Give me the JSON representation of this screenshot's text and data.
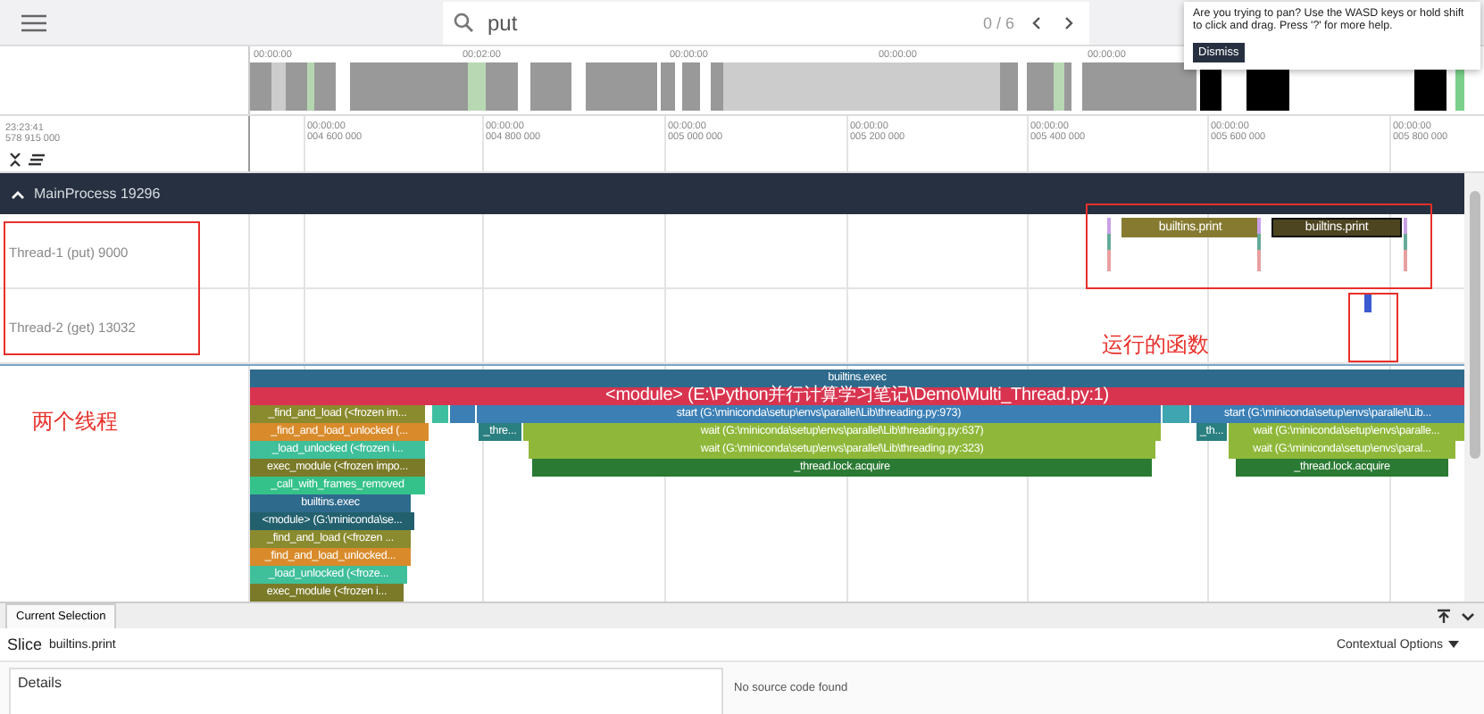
{
  "topbar": {
    "search": {
      "value": "put",
      "count": "0 / 6"
    }
  },
  "toast": {
    "message": "Are you trying to pan? Use the WASD keys or hold shift to click and drag. Press '?' for more help.",
    "button": "Dismiss"
  },
  "overview": {
    "labels": [
      "00:00:00",
      "00:02:00",
      "00:00:00",
      "00:00:00",
      "00:00:00"
    ]
  },
  "time_axis": {
    "start_time": "23:23:41",
    "start_offset": "578 915 000",
    "ticks": [
      {
        "time": "00:00:00",
        "offset": "004 600 000"
      },
      {
        "time": "00:00:00",
        "offset": "004 800 000"
      },
      {
        "time": "00:00:00",
        "offset": "005 000 000"
      },
      {
        "time": "00:00:00",
        "offset": "005 200 000"
      },
      {
        "time": "00:00:00",
        "offset": "005 400 000"
      },
      {
        "time": "00:00:00",
        "offset": "005 600 000"
      },
      {
        "time": "00:00:00",
        "offset": "005 800 000"
      }
    ]
  },
  "process": {
    "name": "MainProcess 19296",
    "expanded": true
  },
  "threads": [
    {
      "name": "Thread-1 (put) 9000",
      "slices": [
        {
          "label": "builtins.print",
          "color": "#857a30",
          "selected": false
        },
        {
          "label": "builtins.print",
          "color": "#4d4420",
          "selected": true
        }
      ]
    },
    {
      "name": "Thread-2 (get) 13032",
      "slices": [
        {
          "color": "#3a5bd0",
          "selected": false
        }
      ]
    }
  ],
  "flame": {
    "levels": [
      {
        "slices": [
          {
            "label": "builtins.exec",
            "color": "#2d6a8c"
          }
        ]
      },
      {
        "slices": [
          {
            "label": "<module> (E:\\Python并行计算学习笔记\\Demo\\Multi_Thread.py:1)",
            "color": "#d9344f"
          }
        ]
      },
      {
        "slices": [
          {
            "label": "_find_and_load (<frozen im...",
            "color": "#8a8a2e"
          },
          {
            "color": "#3fbfa0"
          },
          {
            "color": "#3b7fb5"
          },
          {
            "label": "start (G:\\miniconda\\setup\\envs\\parallel\\Lib\\threading.py:973)",
            "color": "#3b7fb5"
          },
          {
            "color": "#3fa5b0"
          },
          {
            "label": "start (G:\\miniconda\\setup\\envs\\parallel\\Lib...",
            "color": "#3b7fb5"
          }
        ]
      },
      {
        "slices": [
          {
            "label": "_find_and_load_unlocked (...",
            "color": "#d98b2b"
          },
          {
            "label": "_thre...",
            "color": "#2a7f80"
          },
          {
            "label": "wait (G:\\miniconda\\setup\\envs\\parallel\\Lib\\threading.py:637)",
            "color": "#8fb83a"
          },
          {
            "label": "_th...",
            "color": "#2a7f80"
          },
          {
            "label": "wait (G:\\miniconda\\setup\\envs\\paralle...",
            "color": "#8fb83a"
          }
        ]
      },
      {
        "slices": [
          {
            "label": "_load_unlocked (<frozen i...",
            "color": "#3fbf9a"
          },
          {
            "label": "wait (G:\\miniconda\\setup\\envs\\parallel\\Lib\\threading.py:323)",
            "color": "#8fb83a"
          },
          {
            "label": "wait (G:\\miniconda\\setup\\envs\\paral...",
            "color": "#8fb83a"
          }
        ]
      },
      {
        "slices": [
          {
            "label": "exec_module (<frozen impo...",
            "color": "#7a7a28"
          },
          {
            "label": "_thread.lock.acquire",
            "color": "#2a7a33"
          },
          {
            "label": "_thread.lock.acquire",
            "color": "#2a7a33"
          }
        ]
      },
      {
        "slices": [
          {
            "label": "_call_with_frames_removed",
            "color": "#35c28a"
          }
        ]
      },
      {
        "slices": [
          {
            "label": "builtins.exec",
            "color": "#2d6a8c"
          }
        ]
      },
      {
        "slices": [
          {
            "label": "<module> (G:\\miniconda\\se...",
            "color": "#23606e"
          }
        ]
      },
      {
        "slices": [
          {
            "label": "_find_and_load (<frozen ...",
            "color": "#8a8a2e"
          }
        ]
      },
      {
        "slices": [
          {
            "label": "_find_and_load_unlocked...",
            "color": "#d98b2b"
          }
        ]
      },
      {
        "slices": [
          {
            "label": "_load_unlocked (<froze...",
            "color": "#3fbf9a"
          }
        ]
      },
      {
        "slices": [
          {
            "label": "exec_module (<frozen i...",
            "color": "#7a7a28"
          }
        ]
      }
    ]
  },
  "annotations": [
    {
      "text": "两个线程"
    },
    {
      "text": "运行的函数"
    }
  ],
  "selection_panel": {
    "tab": "Current Selection",
    "title": "Slice",
    "slice_name": "builtins.print",
    "contextual": "Contextual Options",
    "details": "Details",
    "source": "No source code found"
  }
}
